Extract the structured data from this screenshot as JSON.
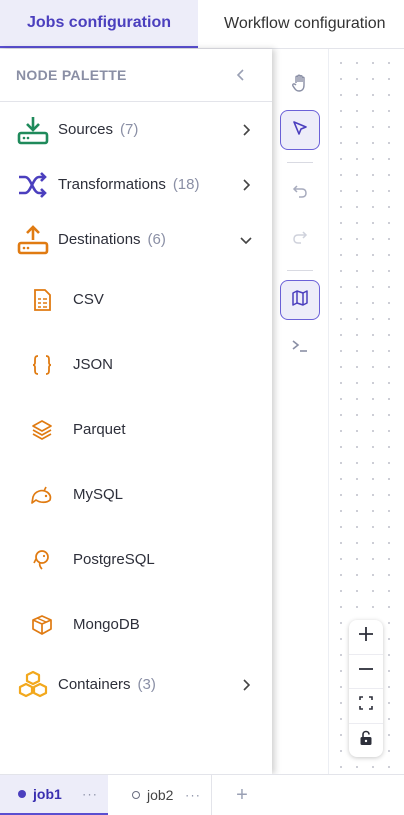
{
  "tabs": [
    {
      "label": "Jobs configuration",
      "active": true
    },
    {
      "label": "Workflow configuration",
      "active": false
    }
  ],
  "palette": {
    "title": "NODE PALETTE",
    "categories": [
      {
        "label": "Sources",
        "count": "(7)",
        "icon": "download-tray-icon",
        "color": "#1f8a5b",
        "expanded": false
      },
      {
        "label": "Transformations",
        "count": "(18)",
        "icon": "shuffle-icon",
        "color": "#4b3fbe",
        "expanded": false
      },
      {
        "label": "Destinations",
        "count": "(6)",
        "icon": "upload-tray-icon",
        "color": "#e07b12",
        "expanded": true
      },
      {
        "label": "Containers",
        "count": "(3)",
        "icon": "cubes-icon",
        "color": "#f2a81d",
        "expanded": false
      }
    ],
    "destinations": [
      {
        "label": "CSV",
        "icon": "csv-file-icon"
      },
      {
        "label": "JSON",
        "icon": "json-braces-icon"
      },
      {
        "label": "Parquet",
        "icon": "layers-icon"
      },
      {
        "label": "MySQL",
        "icon": "dolphin-icon"
      },
      {
        "label": "PostgreSQL",
        "icon": "elephant-icon"
      },
      {
        "label": "MongoDB",
        "icon": "database-box-icon"
      }
    ]
  },
  "toolbar": [
    "hand-icon",
    "pointer-icon",
    "undo-icon",
    "redo-icon",
    "map-icon",
    "terminal-icon"
  ],
  "zoom_controls": [
    "zoom-in-icon",
    "zoom-out-icon",
    "fit-view-icon",
    "lock-icon"
  ],
  "jobs": [
    {
      "label": "job1",
      "active": true
    },
    {
      "label": "job2",
      "active": false
    }
  ],
  "job_more_label": "···",
  "add_job_label": "+",
  "colors": {
    "accent": "#5a4fd1",
    "accent_bg": "#ededf9",
    "orange": "#e07b12"
  }
}
